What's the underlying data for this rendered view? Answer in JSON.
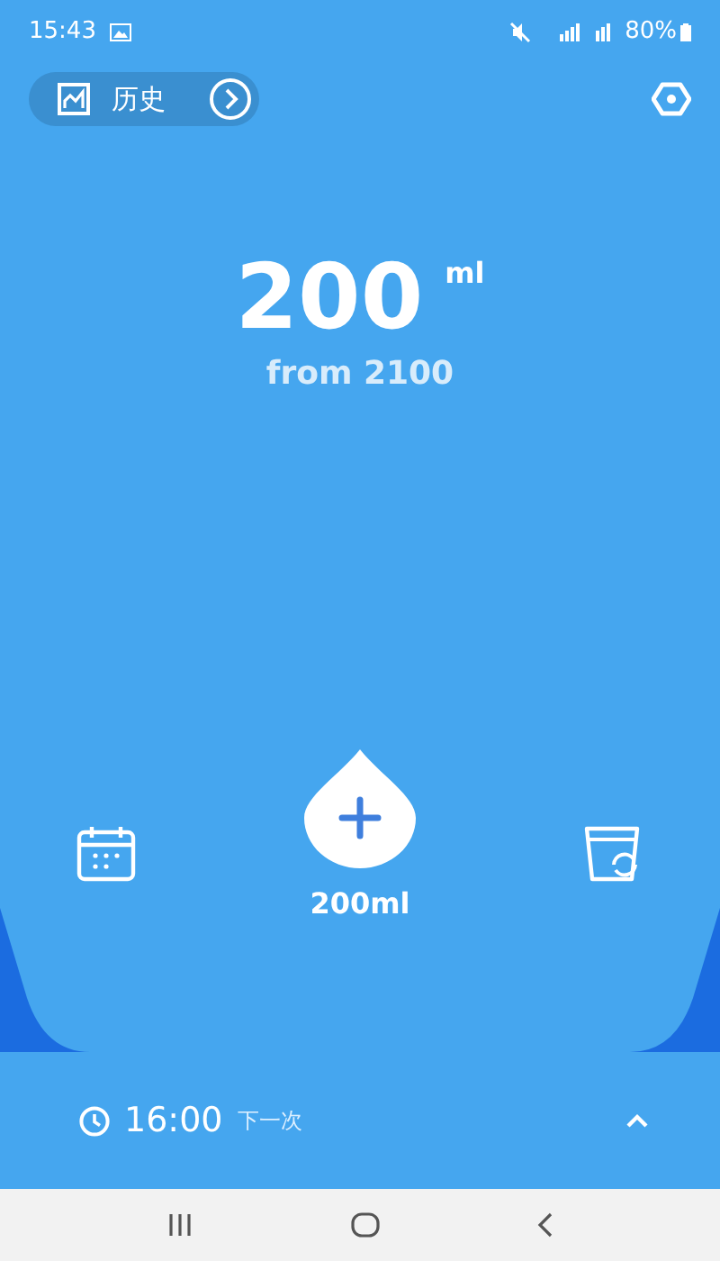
{
  "status_bar": {
    "time": "15:43",
    "battery": "80%"
  },
  "history_button": {
    "label": "历史"
  },
  "intake": {
    "amount": "200",
    "unit": "ml",
    "goal": "from 2100"
  },
  "add_button": {
    "amount": "200ml"
  },
  "reminder": {
    "time": "16:00",
    "label": "下一次"
  }
}
